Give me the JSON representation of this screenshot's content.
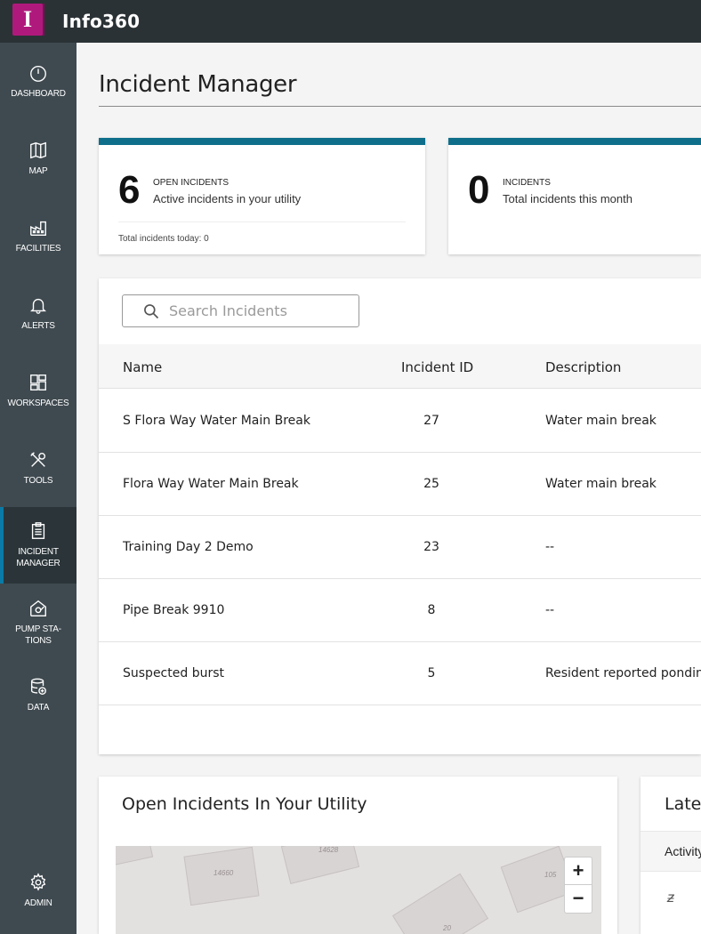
{
  "app": {
    "title": "Info360",
    "logo_letter": "I"
  },
  "sidebar": {
    "items": [
      {
        "label": "DASHBOARD",
        "icon": "gauge-icon"
      },
      {
        "label": "MAP",
        "icon": "map-icon"
      },
      {
        "label": "FACILITIES",
        "icon": "factory-icon"
      },
      {
        "label": "ALERTS",
        "icon": "bell-icon"
      },
      {
        "label": "WORKSPACES",
        "icon": "grid-icon"
      },
      {
        "label": "TOOLS",
        "icon": "tools-icon"
      },
      {
        "label": "INCIDENT MANAGER",
        "icon": "clipboard-icon",
        "active": true
      },
      {
        "label": "PUMP STA-TIONS",
        "icon": "pump-station-icon"
      },
      {
        "label": "DATA",
        "icon": "database-icon"
      },
      {
        "label": "ADMIN",
        "icon": "gear-icon"
      }
    ]
  },
  "page": {
    "title": "Incident Manager"
  },
  "stats": [
    {
      "value": "6",
      "caption": "OPEN INCIDENTS",
      "subtitle": "Active incidents in your utility",
      "footer": "Total incidents today: 0"
    },
    {
      "value": "0",
      "caption": "INCIDENTS",
      "subtitle": "Total incidents this month"
    }
  ],
  "search": {
    "placeholder": "Search Incidents"
  },
  "table": {
    "headers": {
      "name": "Name",
      "id": "Incident ID",
      "description": "Description"
    },
    "rows": [
      {
        "name": "S Flora Way Water Main Break",
        "id": "27",
        "description": "Water main break"
      },
      {
        "name": "Flora Way Water Main Break",
        "id": "25",
        "description": "Water main break"
      },
      {
        "name": "Training Day 2 Demo",
        "id": "23",
        "description": "--"
      },
      {
        "name": "Pipe Break 9910",
        "id": "8",
        "description": "--"
      },
      {
        "name": "Suspected burst",
        "id": "5",
        "description": "Resident reported ponding"
      }
    ]
  },
  "map_panel": {
    "title": "Open Incidents In Your Utility",
    "zoom_in": "+",
    "zoom_out": "−",
    "labels": [
      "14660",
      "14628",
      "105",
      "20"
    ]
  },
  "latest_panel": {
    "title": "Latest",
    "column": "Activity"
  }
}
